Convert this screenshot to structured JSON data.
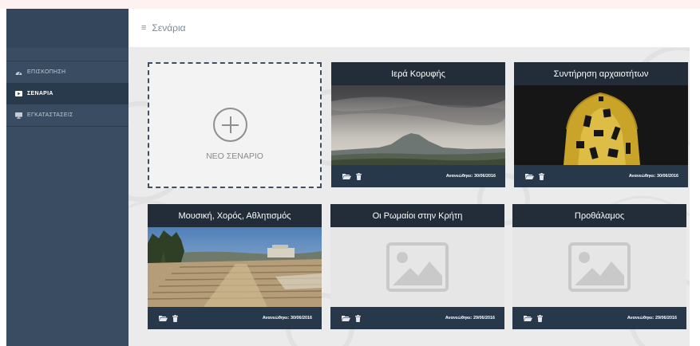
{
  "header": {
    "title": "Σενάρια",
    "menu_icon": "hamburger-icon"
  },
  "sidebar": {
    "items": [
      {
        "label": "ΕΠΙΣΚΟΠΗΣΗ",
        "icon": "dashboard-icon",
        "active": false
      },
      {
        "label": "ΣΕΝΑΡΙΑ",
        "icon": "play-icon",
        "active": true
      },
      {
        "label": "ΕΓΚΑΤΑΣΤΑΣΕΙΣ",
        "icon": "monitor-icon",
        "active": false
      }
    ]
  },
  "new_scenario": {
    "label": "ΝΕΟ ΣΕΝΑΡΙΟ",
    "icon": "plus-circle-icon"
  },
  "cards": [
    {
      "title": "Ιερά Κορυφής",
      "updated": "Ανανεώθηκε: 30/06/2016",
      "image": "mountain-photo"
    },
    {
      "title": "Συντήρηση αρχαιοτήτων",
      "updated": "Ανανεώθηκε: 30/06/2016",
      "image": "gold-artifact-photo"
    },
    {
      "title": "Μουσική, Χορός, Αθλητισμός",
      "updated": "Ανανεώθηκε: 30/06/2016",
      "image": "theatre-ruins-photo"
    },
    {
      "title": "Οι Ρωμαίοι στην Κρήτη",
      "updated": "Ανανεώθηκε: 29/06/2016",
      "image": "image-placeholder-icon"
    },
    {
      "title": "Προθάλαμος",
      "updated": "Ανανεώθηκε: 29/06/2016",
      "image": "image-placeholder-icon"
    }
  ],
  "card_actions": {
    "open_icon": "folder-open-icon",
    "delete_icon": "trash-icon"
  },
  "colors": {
    "sidebar": "#3a4c62",
    "sidebar_active": "#2a3a4d",
    "card_title_bar": "#232d39",
    "card_footer": "#27384b",
    "background": "#ebebeb"
  }
}
